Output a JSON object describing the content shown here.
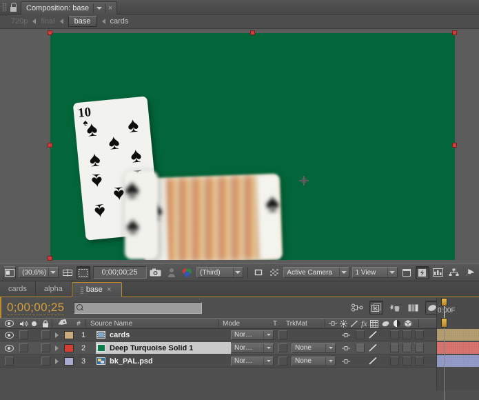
{
  "window": {
    "panel_title": "Composition: base",
    "close_label": "×",
    "lock_icon": "lock-icon",
    "menu_icon": "panel-menu-icon"
  },
  "breadcrumb": {
    "items": [
      {
        "label": "720p",
        "state": "parent"
      },
      {
        "label": "final",
        "state": "parent"
      },
      {
        "label": "base",
        "state": "active"
      },
      {
        "label": "cards",
        "state": "child"
      }
    ]
  },
  "viewer": {
    "background_color": "#5c5c5c",
    "comp_background_color": "#02663a",
    "selection_handle_color": "#d03b3b",
    "anchor_icon": "anchor-point-icon",
    "cards": {
      "front_card": {
        "rank": "10",
        "suit_glyph": "♠",
        "suit_name": "spades"
      },
      "blurred_card": {
        "suit_glyph": "♠",
        "suit_name": "spades",
        "description": "motion-blurred face card"
      }
    }
  },
  "viewer_toolbar": {
    "always_preview_icon": "always-preview-this-view-icon",
    "zoom_value": "(30,6%)",
    "grid_guides_icon": "choose-grid-and-guide-options-icon",
    "region_of_interest_icon": "region-of-interest-icon",
    "timecode": "0;00;00;25",
    "snapshot_icon": "take-snapshot-icon",
    "show_snapshot_icon": "show-snapshot-icon",
    "channels_icon": "show-channel-icon",
    "resolution_value": "(Third)",
    "toggle_mask_icon": "toggle-mask-and-shape-path-visibility-icon",
    "transparency_grid_icon": "toggle-transparency-grid-icon",
    "camera_value": "Active Camera",
    "views_value": "1 View",
    "pixel_aspect_icon": "toggle-pixel-aspect-ratio-correction-icon",
    "fast_previews_icon": "fast-previews-icon",
    "timeline_icon": "composition-timeline-icon",
    "flowchart_icon": "composition-flowchart-icon",
    "reset_exposure_icon": "reset-exposure-icon"
  },
  "timeline": {
    "tabs": [
      {
        "label": "cards",
        "active": false,
        "closable": false
      },
      {
        "label": "alpha",
        "active": false,
        "closable": false
      },
      {
        "label": "base",
        "active": true,
        "closable": true,
        "close_label": "×"
      }
    ],
    "current_time": "0;00;00;25",
    "search_placeholder": "",
    "search_icon": "search-icon",
    "search_value": "",
    "ruler_label": "0:00F",
    "switches": [
      {
        "icon": "live-update-icon",
        "pressed": false
      },
      {
        "icon": "draft-3d-icon",
        "pressed": true
      },
      {
        "icon": "hide-shy-layers-icon",
        "pressed": false
      },
      {
        "icon": "enable-frame-blending-icon",
        "pressed": false
      },
      {
        "icon": "enable-motion-blur-icon",
        "pressed": false
      },
      {
        "icon": "brainstorm-icon",
        "pressed": true
      },
      {
        "icon": "auto-keyframe-icon",
        "pressed": false
      },
      {
        "icon": "graph-editor-icon",
        "pressed": false
      }
    ],
    "columns": {
      "av_icons": [
        "eye-icon",
        "audio-icon",
        "solo-icon",
        "lock-icon"
      ],
      "label_icon": "label-icon",
      "index": "#",
      "source_name": "Source Name",
      "mode": "Mode",
      "t": "T",
      "trkmat": "TrkMat",
      "switch_icons": [
        "shy-icon",
        "collapse-transformations-icon",
        "quality-icon",
        "effects-icon",
        "frame-blending-icon",
        "motion-blur-icon",
        "adjustment-layer-icon",
        "3d-layer-icon"
      ]
    },
    "layers": [
      {
        "index": "1",
        "source_name": "cards",
        "type_icon": "composition-icon",
        "visible": true,
        "selected": false,
        "label_color": "#c9ab7e",
        "bar_color": "#b09a6c",
        "mode": "Nor…",
        "trkmat": "",
        "has_trkmat": false
      },
      {
        "index": "2",
        "source_name": "Deep Turquoise Solid 1",
        "type_icon": "solid-icon",
        "visible": true,
        "selected": true,
        "label_color": "#d43f34",
        "bar_color": "#d4706a",
        "mode": "Nor…",
        "trkmat": "None",
        "has_trkmat": true
      },
      {
        "index": "3",
        "source_name": "bk_PAL.psd",
        "type_icon": "psd-layer-icon",
        "visible": false,
        "selected": false,
        "label_color": "#a9accf",
        "bar_color": "#8f95c4",
        "mode": "Nor…",
        "trkmat": "None",
        "has_trkmat": true
      }
    ]
  },
  "colors": {
    "accent_orange": "#c08a28",
    "timecode_orange": "#d5a03c",
    "panel_gray": "#4f4f4f",
    "comp_green": "#02663a"
  }
}
